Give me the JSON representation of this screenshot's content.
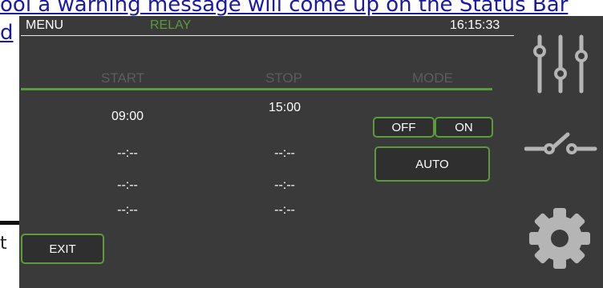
{
  "background": {
    "line1": "ool a warning message will come up on the Status Bar",
    "line2": "d",
    "left_char": "t"
  },
  "topbar": {
    "menu_label": "MENU",
    "page_label": "RELAY",
    "clock": "16:15:33"
  },
  "table": {
    "headers": [
      "START",
      "STOP",
      "MODE"
    ],
    "rows": [
      {
        "start": "09:00",
        "stop": "15:00"
      },
      {
        "start": "--:--",
        "stop": "--:--"
      },
      {
        "start": "--:--",
        "stop": "--:--"
      },
      {
        "start": "--:--",
        "stop": "--:--"
      }
    ]
  },
  "mode": {
    "off_label": "OFF",
    "on_label": "ON",
    "auto_label": "AUTO"
  },
  "exit_label": "EXIT",
  "sidebar": {
    "icons": [
      "sliders-icon",
      "switch-icon",
      "gear-icon"
    ]
  },
  "colors": {
    "panel_bg": "#3a3a3a",
    "accent_green": "#5b9b3b",
    "header_gray": "#5d5d5d",
    "icon_gray": "#b5b5b5"
  }
}
